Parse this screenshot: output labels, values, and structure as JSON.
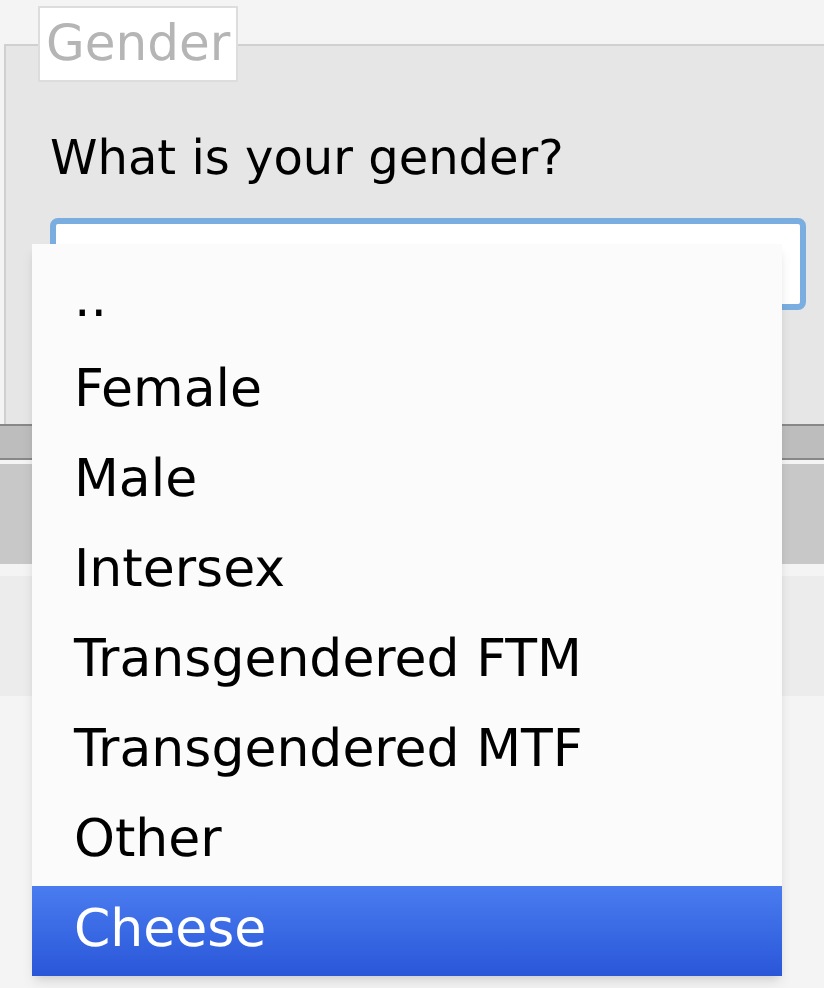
{
  "fieldset": {
    "legend": "Gender",
    "question": "What is your gender?"
  },
  "dropdown": {
    "expanded": true,
    "options": [
      {
        "label": "..",
        "selected": false
      },
      {
        "label": "Female",
        "selected": false
      },
      {
        "label": "Male",
        "selected": false
      },
      {
        "label": "Intersex",
        "selected": false
      },
      {
        "label": "Transgendered FTM",
        "selected": false
      },
      {
        "label": "Transgendered MTF",
        "selected": false
      },
      {
        "label": "Other",
        "selected": false
      },
      {
        "label": "Cheese",
        "selected": true
      }
    ]
  }
}
